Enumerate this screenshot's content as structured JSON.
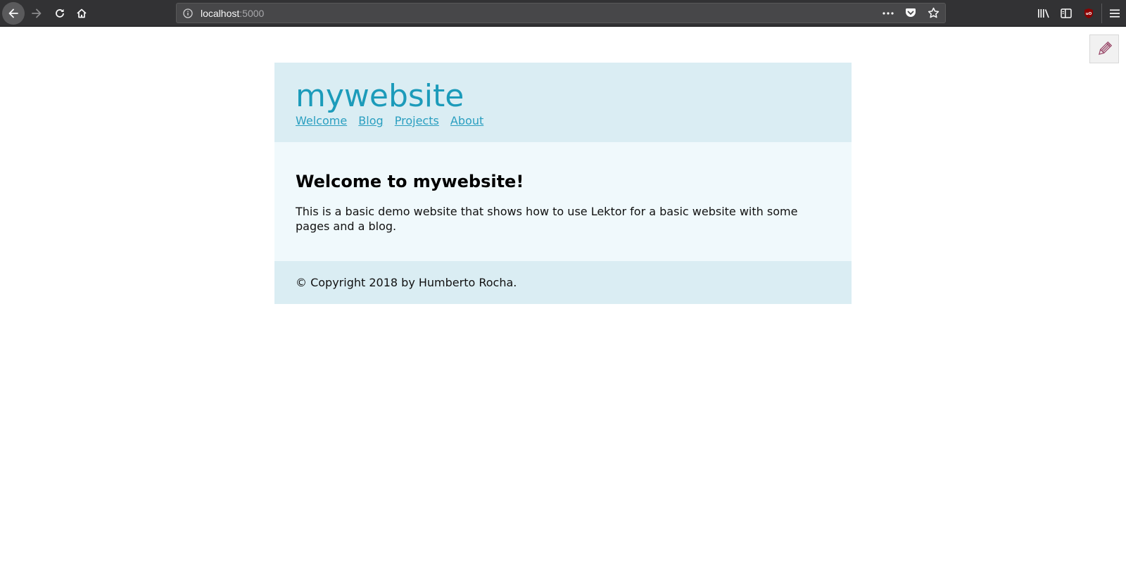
{
  "browser": {
    "url_host": "localhost",
    "url_port": ":5000",
    "icons": {
      "back": "arrow-left-icon",
      "forward": "arrow-right-icon",
      "reload": "reload-icon",
      "home": "home-icon",
      "info": "info-icon",
      "more": "ellipsis-icon",
      "pocket": "pocket-icon",
      "bookmark": "star-icon",
      "library": "library-icon",
      "sidebar": "sidebar-icon",
      "ublock": "ublock-icon",
      "menu": "hamburger-menu-icon"
    }
  },
  "lektor": {
    "edit_icon": "pencil-icon",
    "edit_glyph": "✎"
  },
  "site": {
    "title": "mywebsite",
    "nav": [
      {
        "label": "Welcome"
      },
      {
        "label": "Blog"
      },
      {
        "label": "Projects"
      },
      {
        "label": "About"
      }
    ],
    "heading": "Welcome to mywebsite!",
    "intro": "This is a basic demo website that shows how to use Lektor for a basic website with some pages and a blog.",
    "footer": "© Copyright 2018 by Humberto Rocha.",
    "colors": {
      "header_bg": "#daedf3",
      "body_bg": "#f0f9fc",
      "title": "#1c9bba",
      "link": "#2a9fc0"
    }
  }
}
